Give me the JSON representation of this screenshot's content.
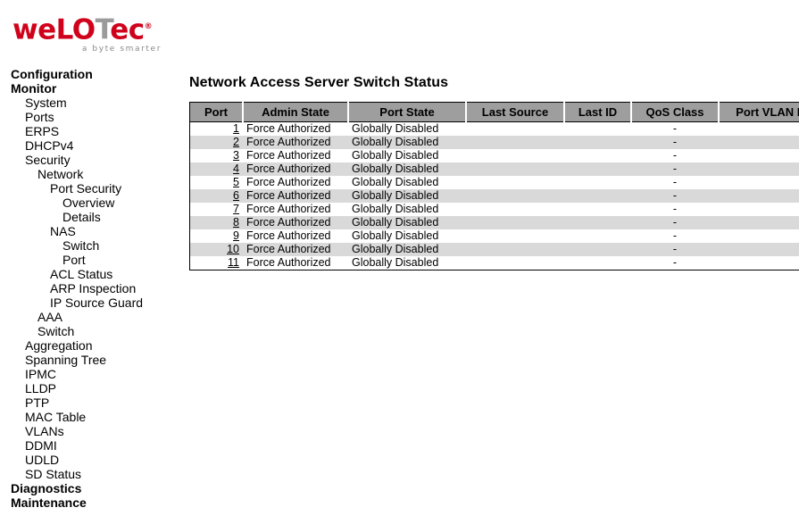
{
  "brand": {
    "name_part1": "weLO",
    "name_t": "T",
    "name_part2": "ec",
    "registered": "®",
    "tagline": "a byte smarter",
    "red": "#d0021b",
    "gray": "#9b9b9b"
  },
  "sidebar": {
    "items": [
      {
        "label": "Configuration",
        "level": "top",
        "bold": true
      },
      {
        "label": "Monitor",
        "level": "top",
        "bold": true
      },
      {
        "label": "System",
        "level": "lvl1",
        "bold": false
      },
      {
        "label": "Ports",
        "level": "lvl1",
        "bold": false
      },
      {
        "label": "ERPS",
        "level": "lvl1",
        "bold": false
      },
      {
        "label": "DHCPv4",
        "level": "lvl1",
        "bold": false
      },
      {
        "label": "Security",
        "level": "lvl1",
        "bold": false
      },
      {
        "label": "Network",
        "level": "lvl2",
        "bold": false
      },
      {
        "label": "Port Security",
        "level": "lvl3",
        "bold": false
      },
      {
        "label": "Overview",
        "level": "lvl4",
        "bold": false
      },
      {
        "label": "Details",
        "level": "lvl4",
        "bold": false
      },
      {
        "label": "NAS",
        "level": "lvl3",
        "bold": false
      },
      {
        "label": "Switch",
        "level": "lvl4",
        "bold": false
      },
      {
        "label": "Port",
        "level": "lvl4",
        "bold": false
      },
      {
        "label": "ACL Status",
        "level": "lvl3",
        "bold": false
      },
      {
        "label": "ARP Inspection",
        "level": "lvl3",
        "bold": false
      },
      {
        "label": "IP Source Guard",
        "level": "lvl3",
        "bold": false
      },
      {
        "label": "AAA",
        "level": "lvl2",
        "bold": false
      },
      {
        "label": "Switch",
        "level": "lvl2",
        "bold": false
      },
      {
        "label": "Aggregation",
        "level": "lvl1",
        "bold": false
      },
      {
        "label": "Spanning Tree",
        "level": "lvl1",
        "bold": false
      },
      {
        "label": "IPMC",
        "level": "lvl1",
        "bold": false
      },
      {
        "label": "LLDP",
        "level": "lvl1",
        "bold": false
      },
      {
        "label": "PTP",
        "level": "lvl1",
        "bold": false
      },
      {
        "label": "MAC Table",
        "level": "lvl1",
        "bold": false
      },
      {
        "label": "VLANs",
        "level": "lvl1",
        "bold": false
      },
      {
        "label": "DDMI",
        "level": "lvl1",
        "bold": false
      },
      {
        "label": "UDLD",
        "level": "lvl1",
        "bold": false
      },
      {
        "label": "SD Status",
        "level": "lvl1",
        "bold": false
      },
      {
        "label": "Diagnostics",
        "level": "top",
        "bold": true
      },
      {
        "label": "Maintenance",
        "level": "top",
        "bold": true
      }
    ]
  },
  "main": {
    "title": "Network Access Server Switch Status",
    "table": {
      "columns": [
        "Port",
        "Admin State",
        "Port State",
        "Last Source",
        "Last ID",
        "QoS Class",
        "Port VLAN ID"
      ],
      "rows": [
        {
          "port": "1",
          "admin_state": "Force Authorized",
          "port_state": "Globally Disabled",
          "last_source": "",
          "last_id": "",
          "qos_class": "-",
          "port_vlan_id": ""
        },
        {
          "port": "2",
          "admin_state": "Force Authorized",
          "port_state": "Globally Disabled",
          "last_source": "",
          "last_id": "",
          "qos_class": "-",
          "port_vlan_id": ""
        },
        {
          "port": "3",
          "admin_state": "Force Authorized",
          "port_state": "Globally Disabled",
          "last_source": "",
          "last_id": "",
          "qos_class": "-",
          "port_vlan_id": ""
        },
        {
          "port": "4",
          "admin_state": "Force Authorized",
          "port_state": "Globally Disabled",
          "last_source": "",
          "last_id": "",
          "qos_class": "-",
          "port_vlan_id": ""
        },
        {
          "port": "5",
          "admin_state": "Force Authorized",
          "port_state": "Globally Disabled",
          "last_source": "",
          "last_id": "",
          "qos_class": "-",
          "port_vlan_id": ""
        },
        {
          "port": "6",
          "admin_state": "Force Authorized",
          "port_state": "Globally Disabled",
          "last_source": "",
          "last_id": "",
          "qos_class": "-",
          "port_vlan_id": ""
        },
        {
          "port": "7",
          "admin_state": "Force Authorized",
          "port_state": "Globally Disabled",
          "last_source": "",
          "last_id": "",
          "qos_class": "-",
          "port_vlan_id": ""
        },
        {
          "port": "8",
          "admin_state": "Force Authorized",
          "port_state": "Globally Disabled",
          "last_source": "",
          "last_id": "",
          "qos_class": "-",
          "port_vlan_id": ""
        },
        {
          "port": "9",
          "admin_state": "Force Authorized",
          "port_state": "Globally Disabled",
          "last_source": "",
          "last_id": "",
          "qos_class": "-",
          "port_vlan_id": ""
        },
        {
          "port": "10",
          "admin_state": "Force Authorized",
          "port_state": "Globally Disabled",
          "last_source": "",
          "last_id": "",
          "qos_class": "-",
          "port_vlan_id": ""
        },
        {
          "port": "11",
          "admin_state": "Force Authorized",
          "port_state": "Globally Disabled",
          "last_source": "",
          "last_id": "",
          "qos_class": "-",
          "port_vlan_id": ""
        }
      ]
    }
  }
}
